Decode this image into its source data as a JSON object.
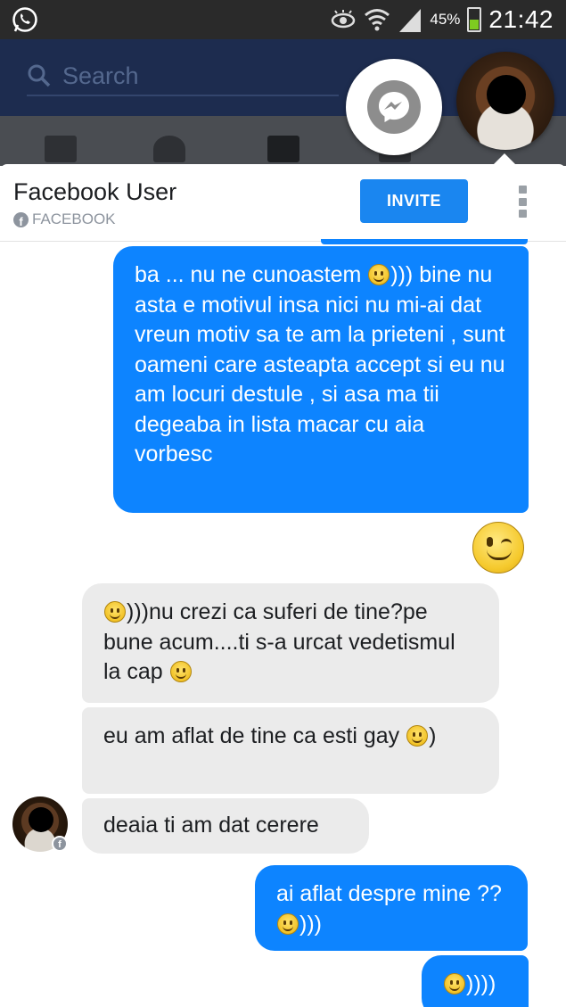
{
  "status_bar": {
    "battery_percent": "45%",
    "time": "21:42",
    "icons": [
      "whatsapp-icon",
      "eye-icon",
      "wifi-icon",
      "signal-icon",
      "battery-icon"
    ]
  },
  "background_app": {
    "search_placeholder": "Search",
    "tabs": [
      "news-feed-tab",
      "friends-tab",
      "messages-tab",
      "notifications-tab",
      "menu-tab"
    ]
  },
  "chat_header": {
    "contact_name": "Facebook User",
    "contact_source": "FACEBOOK",
    "invite_label": "INVITE"
  },
  "messages": [
    {
      "direction": "sent",
      "text": "ba ... nu ne cunoastem ",
      "emoji_after": true,
      "suffix": ")))",
      "text2": "bine nu asta e motivul insa nici nu mi-ai dat vreun motiv sa te am la prieteni , sunt oameni care asteapta accept si eu nu am locuri destule , si asa ma tii degeaba in lista macar cu aia vorbesc"
    },
    {
      "direction": "sent",
      "type": "sticker",
      "sticker": "wink-emoji"
    },
    {
      "direction": "received",
      "prefix": ")))nu crezi ca suferi de tine?pe bune acum....ti s-a urcat vedetismul la cap "
    },
    {
      "direction": "received",
      "text": "eu am aflat de tine ca esti gay ",
      "suffix": ")"
    },
    {
      "direction": "received",
      "text": "deaia ti am dat cerere"
    },
    {
      "direction": "sent",
      "text": "ai aflat despre mine ?? ",
      "suffix": ")))"
    },
    {
      "direction": "sent",
      "suffix": "))))"
    }
  ],
  "colors": {
    "sent_bubble": "#0d84ff",
    "received_bubble": "#ebebeb",
    "invite_button": "#1a86f0",
    "fb_header": "#1d2c4f"
  }
}
